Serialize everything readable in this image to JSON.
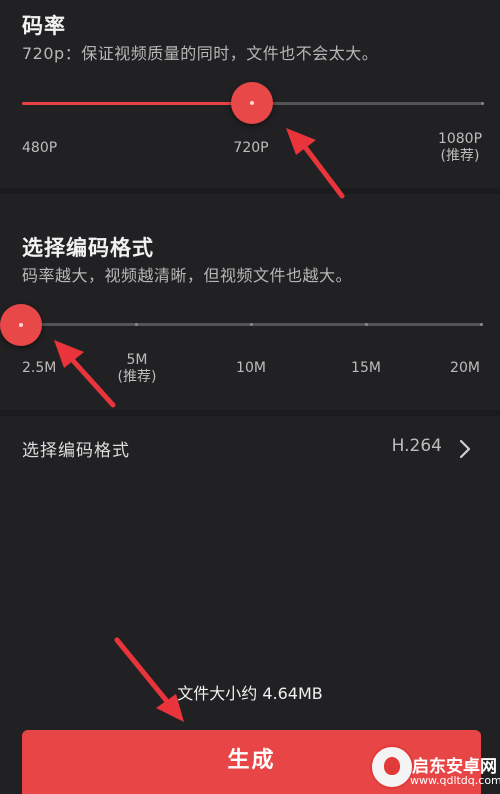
{
  "resolution": {
    "title": "码率",
    "description": "720p：保证视频质量的同时，文件也不会太大。",
    "slider_value": "720P",
    "labels": [
      "480P",
      "720P",
      "1080P",
      "(推荐)"
    ]
  },
  "bitrate": {
    "title": "选择编码格式",
    "description": "码率越大，视频越清晰，但视频文件也越大。",
    "slider_value": "2.5M",
    "labels": [
      "2.5M",
      "5M",
      "(推荐)",
      "10M",
      "15M",
      "20M"
    ]
  },
  "codec": {
    "label": "选择编码格式",
    "value": "H.264"
  },
  "footer": {
    "file_size": "文件大小约 4.64MB",
    "generate_label": "生成"
  },
  "watermark": {
    "name": "启东安卓网",
    "url": "www.qdltdq.com"
  },
  "colors": {
    "accent": "#e84646",
    "background": "#1b1b1d",
    "panel": "#212123",
    "arrow": "#e8343a"
  }
}
